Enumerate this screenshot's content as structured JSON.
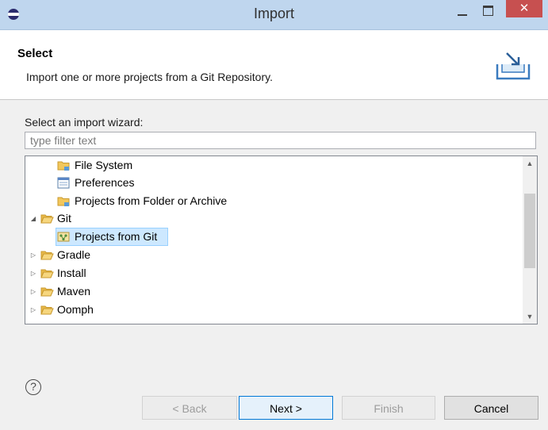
{
  "window": {
    "title": "Import"
  },
  "header": {
    "title": "Select",
    "description": "Import one or more projects from a Git Repository."
  },
  "wizard": {
    "select_label": "Select an import wizard:",
    "filter_placeholder": "type filter text"
  },
  "tree": {
    "items": [
      {
        "label": "File System",
        "icon": "folder-icon",
        "level": 1,
        "expanded": null
      },
      {
        "label": "Preferences",
        "icon": "preferences-icon",
        "level": 1,
        "expanded": null
      },
      {
        "label": "Projects from Folder or Archive",
        "icon": "folder-icon",
        "level": 1,
        "expanded": null
      },
      {
        "label": "Git",
        "icon": "folder-open-icon",
        "level": 0,
        "expanded": true
      },
      {
        "label": "Projects from Git",
        "icon": "git-import-icon",
        "level": 1,
        "expanded": null,
        "selected": true
      },
      {
        "label": "Gradle",
        "icon": "folder-icon",
        "level": 0,
        "expanded": false
      },
      {
        "label": "Install",
        "icon": "folder-icon",
        "level": 0,
        "expanded": false
      },
      {
        "label": "Maven",
        "icon": "folder-icon",
        "level": 0,
        "expanded": false
      },
      {
        "label": "Oomph",
        "icon": "folder-icon",
        "level": 0,
        "expanded": false
      }
    ]
  },
  "buttons": {
    "help": "?",
    "back": "< Back",
    "next": "Next >",
    "finish": "Finish",
    "cancel": "Cancel"
  },
  "colors": {
    "titlebar": "#bfd6ee",
    "close_button": "#c75050",
    "selection": "#cde8ff",
    "folder": "#e9b949",
    "default_button_border": "#0078d7"
  }
}
